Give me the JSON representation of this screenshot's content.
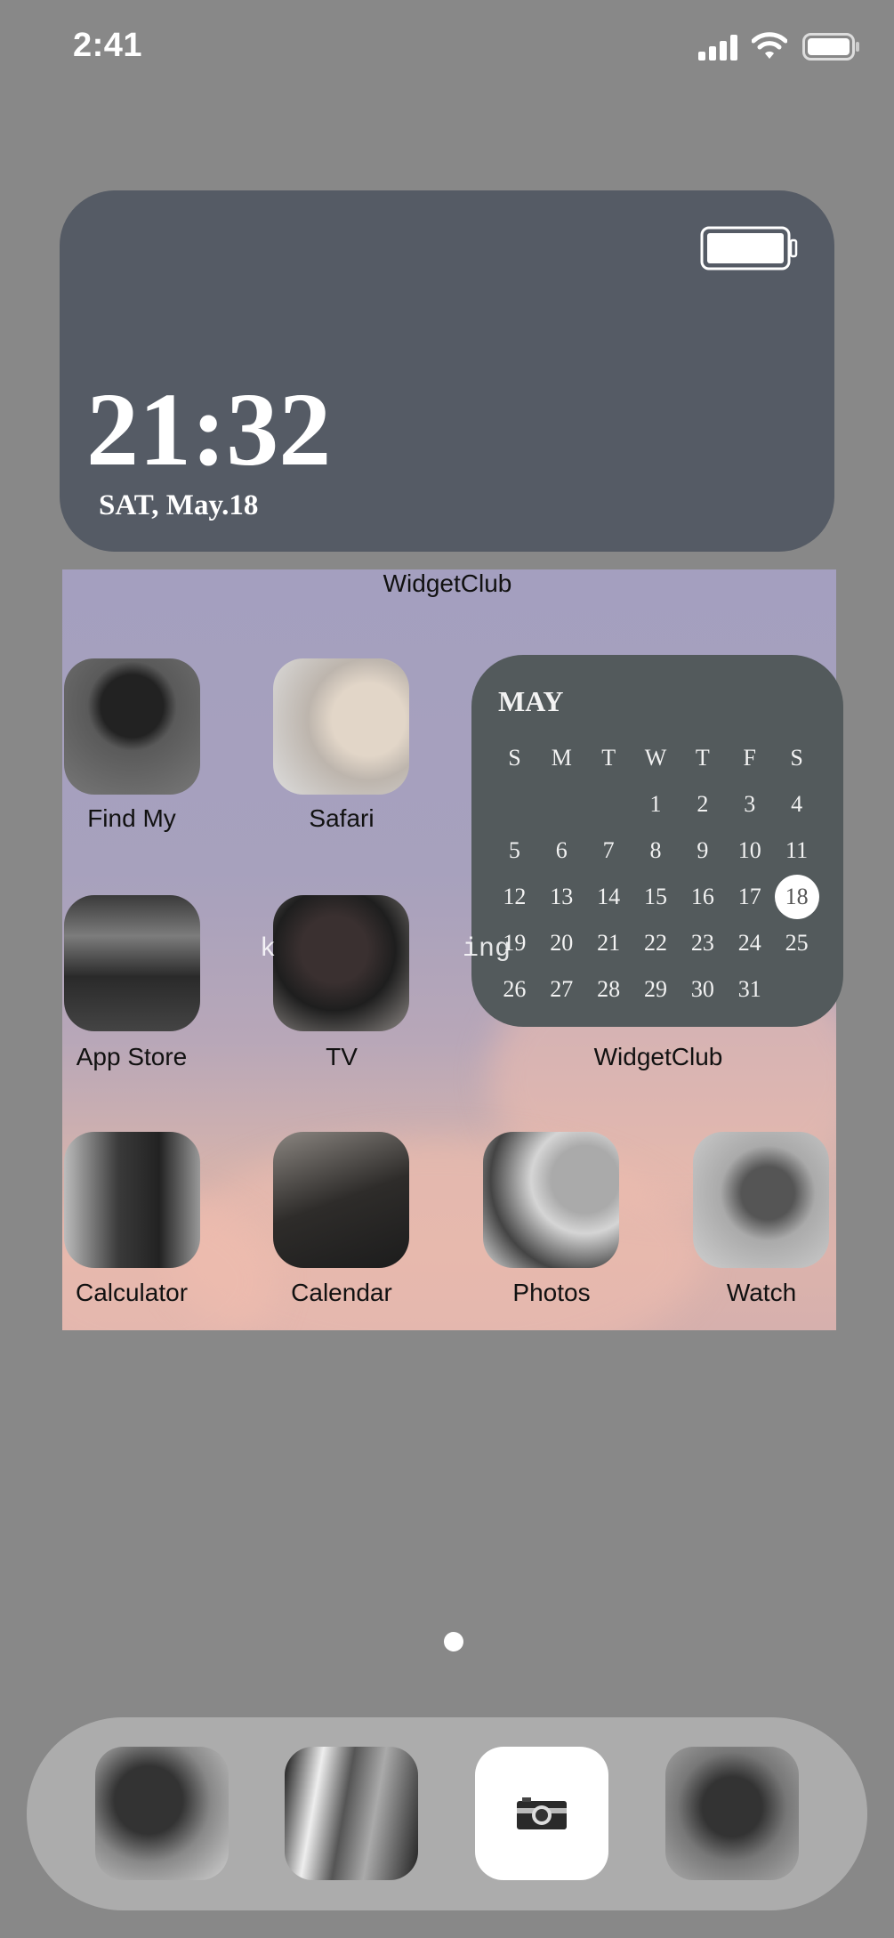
{
  "status_bar": {
    "time": "2:41",
    "icons": [
      "signal-icon",
      "wifi-icon",
      "battery-icon"
    ]
  },
  "clock_widget": {
    "time": "21:32",
    "date": "SAT, May.18",
    "icon": "battery-icon"
  },
  "wallpaper": {
    "overlay_text": "k     ing"
  },
  "widget_labels": {
    "top": "WidgetClub",
    "calendar": "WidgetClub"
  },
  "apps": [
    {
      "label": "Find My"
    },
    {
      "label": "Safari"
    },
    {
      "label": "App Store"
    },
    {
      "label": "TV"
    },
    {
      "label": "Calculator"
    },
    {
      "label": "Calendar"
    },
    {
      "label": "Photos"
    },
    {
      "label": "Watch"
    }
  ],
  "calendar": {
    "month": "MAY",
    "weekdays": [
      "S",
      "M",
      "T",
      "W",
      "T",
      "F",
      "S"
    ],
    "days": [
      "",
      "",
      "",
      "1",
      "2",
      "3",
      "4",
      "5",
      "6",
      "7",
      "8",
      "9",
      "10",
      "11",
      "12",
      "13",
      "14",
      "15",
      "16",
      "17",
      "18",
      "19",
      "20",
      "21",
      "22",
      "23",
      "24",
      "25",
      "26",
      "27",
      "28",
      "29",
      "30",
      "31"
    ],
    "today": "18"
  },
  "dock": {
    "icons": [
      "photo-app-icon",
      "subway-photo-app-icon",
      "camera-app-icon",
      "photo-app-icon"
    ]
  }
}
